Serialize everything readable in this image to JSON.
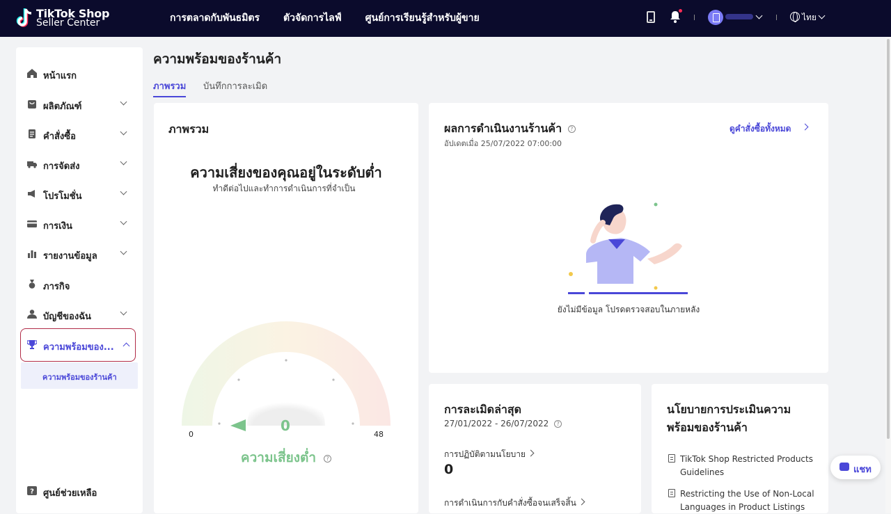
{
  "header": {
    "logo_line1": "TikTok Shop",
    "logo_line2": "Seller Center",
    "nav": [
      "การตลาดกับพันธมิตร",
      "ตัวจัดการไลฟ์",
      "ศูนย์การเรียนรู้สำหรับผู้ขาย"
    ],
    "language": "ไทย"
  },
  "sidebar": {
    "items": [
      {
        "label": "หน้าแรก",
        "icon": "home-icon"
      },
      {
        "label": "ผลิตภัณฑ์",
        "icon": "bag-icon"
      },
      {
        "label": "คำสั่งซื้อ",
        "icon": "orders-icon"
      },
      {
        "label": "การจัดส่ง",
        "icon": "truck-icon"
      },
      {
        "label": "โปรโมชั่น",
        "icon": "megaphone-icon"
      },
      {
        "label": "การเงิน",
        "icon": "card-icon"
      },
      {
        "label": "รายงานข้อมูล",
        "icon": "chart-icon"
      },
      {
        "label": "ภารกิจ",
        "icon": "medal-icon"
      },
      {
        "label": "บัญชีของฉัน",
        "icon": "user-icon"
      },
      {
        "label": "ความพร้อมของ...",
        "icon": "trophy-icon"
      }
    ],
    "sub_item": "ความพร้อมของร้านค้า",
    "help": "ศูนย์ช่วยเหลือ"
  },
  "page": {
    "title": "ความพร้อมของร้านค้า",
    "tabs": [
      "ภาพรวม",
      "บันทึกการละเมิด"
    ]
  },
  "overview": {
    "title": "ภาพรวม",
    "headline": "ความเสี่ยงของคุณอยู่ในระดับต่ำ",
    "subline": "ทำดีต่อไปและทำการดำเนินการที่จำเป็น",
    "gauge": {
      "value": "0",
      "min": "0",
      "max": "48",
      "level_text": "ความเสี่ยงต่ำ",
      "fraction": 0
    }
  },
  "performance": {
    "title": "ผลการดำเนินงานร้านค้า",
    "updated": "อัปเดตเมื่อ 25/07/2022 07:00:00",
    "link": "ดูคำสั่งซื้อทั้งหมด",
    "empty": "ยังไม่มีข้อมูล โปรดตรวจสอบในภายหลัง"
  },
  "violations": {
    "title": "การละเมิดล่าสุด",
    "range": "27/01/2022 - 26/07/2022",
    "item1_label": "การปฏิบัติตามนโยบาย",
    "item1_value": "0",
    "item2_label": "การดำเนินการกับคำสั่งซื้อจนเสร็จสิ้น"
  },
  "policy": {
    "title_line1": "นโยบายการประเมินความ",
    "title_line2": "พร้อมของร้านค้า",
    "links": [
      {
        "line1": "TikTok Shop Restricted Products",
        "line2": "Guidelines"
      },
      {
        "line1": "Restricting the Use of Non-Local",
        "line2": "Languages in Product Listings"
      }
    ]
  },
  "chat": {
    "label": "แชท"
  }
}
